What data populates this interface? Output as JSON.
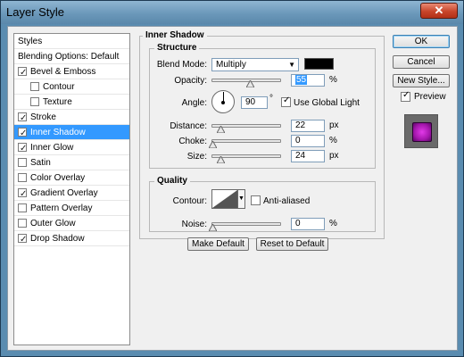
{
  "window": {
    "title": "Layer Style",
    "close_glyph": "✕"
  },
  "styles_list": [
    {
      "label": "Styles",
      "checkbox": false,
      "checked": false,
      "indent": false,
      "selected": false
    },
    {
      "label": "Blending Options: Default",
      "checkbox": false,
      "checked": false,
      "indent": false,
      "selected": false
    },
    {
      "label": "Bevel & Emboss",
      "checkbox": true,
      "checked": true,
      "indent": false,
      "selected": false
    },
    {
      "label": "Contour",
      "checkbox": true,
      "checked": false,
      "indent": true,
      "selected": false
    },
    {
      "label": "Texture",
      "checkbox": true,
      "checked": false,
      "indent": true,
      "selected": false
    },
    {
      "label": "Stroke",
      "checkbox": true,
      "checked": true,
      "indent": false,
      "selected": false
    },
    {
      "label": "Inner Shadow",
      "checkbox": true,
      "checked": true,
      "indent": false,
      "selected": true
    },
    {
      "label": "Inner Glow",
      "checkbox": true,
      "checked": true,
      "indent": false,
      "selected": false
    },
    {
      "label": "Satin",
      "checkbox": true,
      "checked": false,
      "indent": false,
      "selected": false
    },
    {
      "label": "Color Overlay",
      "checkbox": true,
      "checked": false,
      "indent": false,
      "selected": false
    },
    {
      "label": "Gradient Overlay",
      "checkbox": true,
      "checked": true,
      "indent": false,
      "selected": false
    },
    {
      "label": "Pattern Overlay",
      "checkbox": true,
      "checked": false,
      "indent": false,
      "selected": false
    },
    {
      "label": "Outer Glow",
      "checkbox": true,
      "checked": false,
      "indent": false,
      "selected": false
    },
    {
      "label": "Drop Shadow",
      "checkbox": true,
      "checked": true,
      "indent": false,
      "selected": false
    }
  ],
  "inner_shadow": {
    "section_title": "Inner Shadow",
    "structure": {
      "title": "Structure",
      "blend_mode_label": "Blend Mode:",
      "blend_mode_value": "Multiply",
      "shadow_color": "#000000",
      "opacity_label": "Opacity:",
      "opacity_value": "55",
      "opacity_unit": "%",
      "opacity_level": 0.55,
      "angle_label": "Angle:",
      "angle_value": "90",
      "angle_unit": "°",
      "use_global_light_label": "Use Global Light",
      "use_global_light_checked": true,
      "distance_label": "Distance:",
      "distance_value": "22",
      "distance_unit": "px",
      "distance_level": 0.12,
      "choke_label": "Choke:",
      "choke_value": "0",
      "choke_unit": "%",
      "choke_level": 0,
      "size_label": "Size:",
      "size_value": "24",
      "size_unit": "px",
      "size_level": 0.12
    },
    "quality": {
      "title": "Quality",
      "contour_label": "Contour:",
      "anti_aliased_label": "Anti-aliased",
      "anti_aliased_checked": false,
      "noise_label": "Noise:",
      "noise_value": "0",
      "noise_unit": "%",
      "noise_level": 0
    },
    "make_default_label": "Make Default",
    "reset_default_label": "Reset to Default"
  },
  "side_buttons": {
    "ok_label": "OK",
    "cancel_label": "Cancel",
    "new_style_label": "New Style...",
    "preview_label": "Preview",
    "preview_checked": true
  },
  "colors": {
    "selection": "#3399ff",
    "title_bar": "#6b98ba",
    "close_button": "#c8452a",
    "preview_swatch": "#a517ad"
  }
}
